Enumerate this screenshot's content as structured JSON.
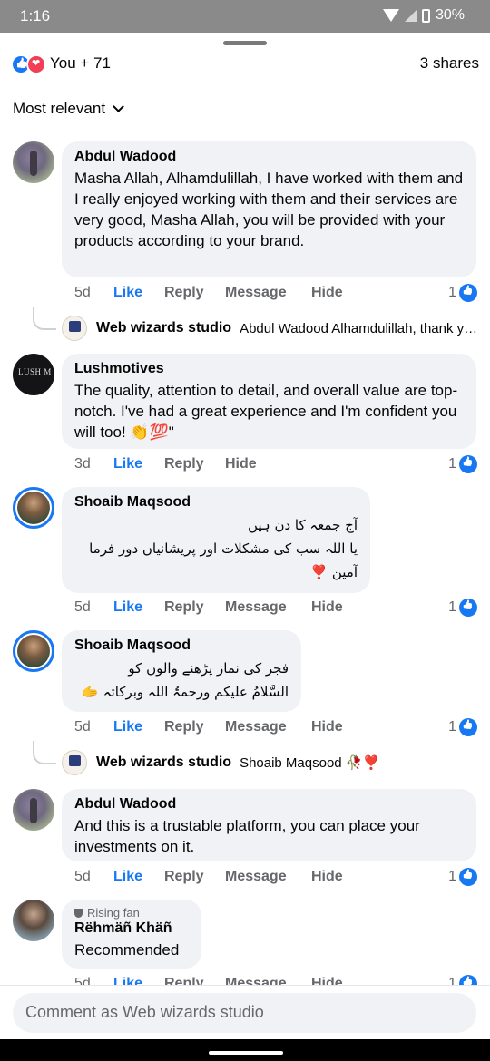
{
  "status_bar": {
    "time": "1:16",
    "battery": "30%"
  },
  "reactions": {
    "summary": "You + 71",
    "shares": "3 shares"
  },
  "sort": {
    "label": "Most relevant"
  },
  "comments": [
    {
      "author": "Abdul Wadood",
      "text": "Masha Allah, Alhamdulillah, I have worked with them and I really enjoyed working with them and their services are very good, Masha Allah, you will be provided with your products according to your brand.",
      "time": "5d",
      "like": "Like",
      "reply": "Reply",
      "message": "Message",
      "hide": "Hide",
      "reaction_count": "1"
    },
    {
      "author": "Lushmotives",
      "avatar_text": "LUSH M",
      "text": "The quality, attention to detail, and overall value are top-notch. I've had a great experience and I'm confident you will too! 👏💯\"",
      "time": "3d",
      "like": "Like",
      "reply": "Reply",
      "hide": "Hide",
      "reaction_count": "1"
    },
    {
      "author": "Shoaib Maqsood",
      "text": "آج جمعہ کا دن ہیں\nیا اللہ سب کی مشکلات اور پریشانیاں دور فرما\nآمین ❣️",
      "time": "5d",
      "like": "Like",
      "reply": "Reply",
      "message": "Message",
      "hide": "Hide",
      "reaction_count": "1"
    },
    {
      "author": "Shoaib Maqsood",
      "text": "فجر کی نماز پڑھنے والوں کو\nالسَّلامُ علیکم ورحمۃُ اللہ وبرکاتہ 🫱",
      "time": "5d",
      "like": "Like",
      "reply": "Reply",
      "message": "Message",
      "hide": "Hide",
      "reaction_count": "1"
    },
    {
      "author": "Abdul Wadood",
      "text": "And this is a trustable platform, you can place your investments on it.",
      "time": "5d",
      "like": "Like",
      "reply": "Reply",
      "message": "Message",
      "hide": "Hide",
      "reaction_count": "1"
    },
    {
      "badge": "Rising fan",
      "author": "Rëhmäñ Khäñ",
      "text": "Recommended",
      "time": "5d",
      "like": "Like",
      "reply": "Reply",
      "message": "Message",
      "hide": "Hide",
      "reaction_count": "1"
    }
  ],
  "replies": [
    {
      "author": "Web wizards studio",
      "text": "Abdul Wadood Alhamdulillah, thank yo..."
    },
    {
      "author": "Web wizards studio",
      "text": "Shoaib Maqsood 🥀❣️"
    }
  ],
  "composer": {
    "placeholder": "Comment as Web wizards studio"
  },
  "colors": {
    "accent": "#1877f2",
    "bubble": "#f0f2f5",
    "status_bar": "#8a8a8a"
  }
}
